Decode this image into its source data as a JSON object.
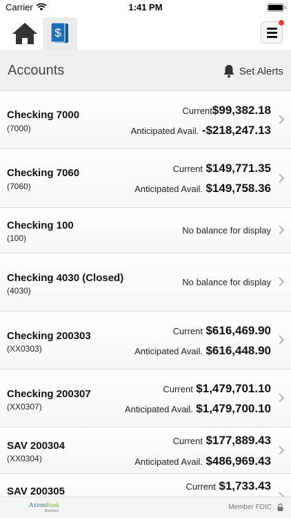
{
  "status_bar": {
    "carrier": "Carrier",
    "time": "1:41 PM"
  },
  "nav": {
    "home_icon": "home-icon",
    "accounts_icon": "dollar-document-icon",
    "menu_icon": "hamburger-menu-icon",
    "badge_color": "#e53935"
  },
  "header": {
    "title": "Accounts",
    "set_alerts_label": "Set Alerts",
    "alerts_icon": "bell-icon"
  },
  "accounts": [
    {
      "name": "Checking 7000",
      "number": "(7000)",
      "current_label": "Current",
      "current": "$99,382.18",
      "avail_label": "Anticipated Avail.",
      "avail": "-$218,247.13"
    },
    {
      "name": "Checking 7060",
      "number": "(7060)",
      "current_label": "Current",
      "current": "$149,771.35",
      "avail_label": "Anticipated Avail.",
      "avail": "$149,758.36"
    },
    {
      "name": "Checking 100",
      "number": "(100)",
      "no_balance": "No balance for display"
    },
    {
      "name": "Checking 4030 (Closed)",
      "number": "(4030)",
      "no_balance": "No balance for display"
    },
    {
      "name": "Checking 200303",
      "number": "(XX0303)",
      "current_label": "Current",
      "current": "$616,469.90",
      "avail_label": "Anticipated Avail.",
      "avail": "$616,448.90"
    },
    {
      "name": "Checking 200307",
      "number": "(XX0307)",
      "current_label": "Current",
      "current": "$1,479,701.10",
      "avail_label": "Anticipated Avail.",
      "avail": "$1,479,700.10"
    },
    {
      "name": "SAV 200304",
      "number": "(XX0304)",
      "current_label": "Current",
      "current": "$177,889.43",
      "avail_label": "Anticipated Avail.",
      "avail": "$486,969.43"
    },
    {
      "name": "SAV 200305",
      "number": "",
      "current_label": "Current",
      "current": "$1,733.43"
    }
  ],
  "footer": {
    "logo_main": "Axiom",
    "logo_bank": "Bank",
    "logo_sub": "Business",
    "member_fdic": "Member FDIC",
    "lock_icon": "lock-icon"
  },
  "colors": {
    "accent_blue": "#1f6fb5",
    "header_bg": "#efefef"
  }
}
